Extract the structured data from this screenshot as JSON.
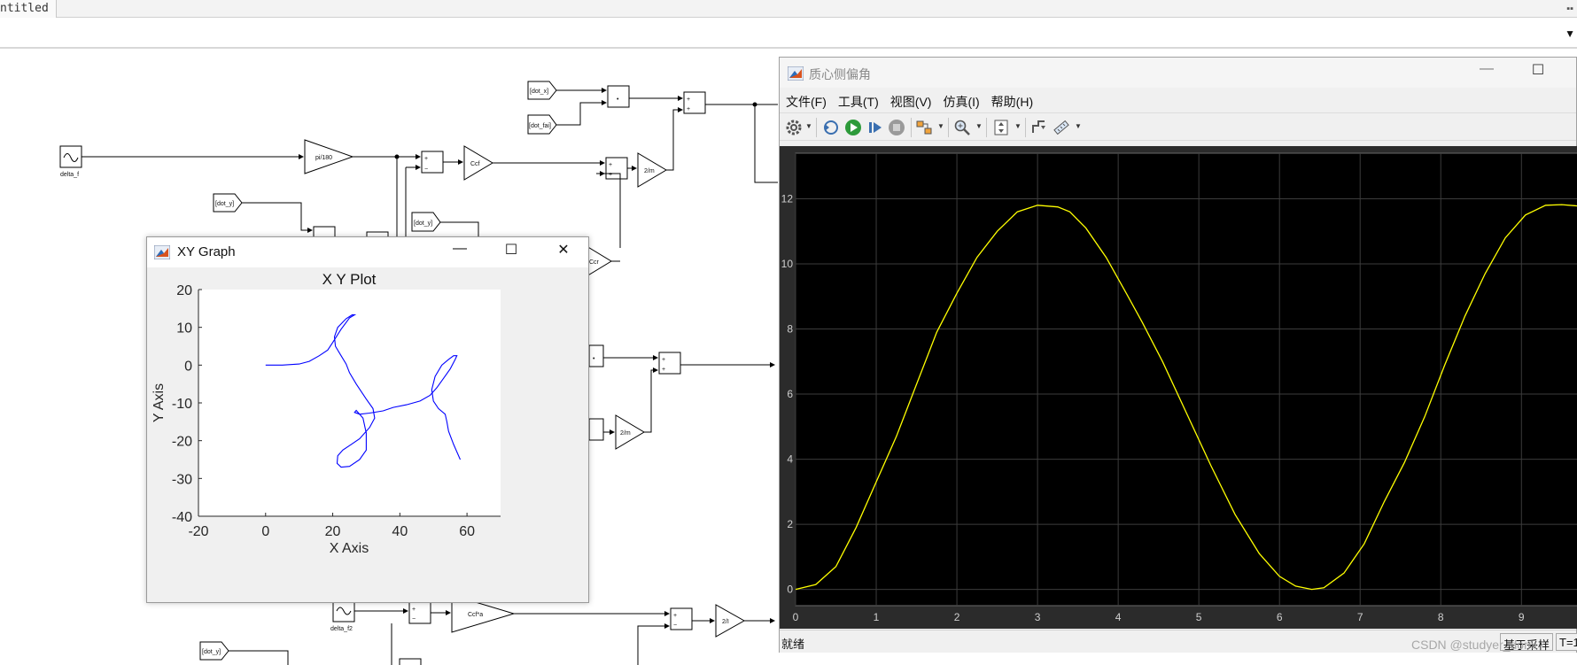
{
  "document": {
    "tab_label": "ntitled"
  },
  "model": {
    "blocks": {
      "delta_f": "delta_f",
      "gain_pi180": "pi/180",
      "dot_y_1": "[dot_y]",
      "dot_y_2": "[dot_y]",
      "dot_y_3": "[dot_y]",
      "dot_x": "[dot_x]",
      "dot_fai": "[dot_fai]",
      "ccf": "Ccf",
      "ccr": "Ccr",
      "gain_2m_1": "2/m",
      "gain_2m_2": "2/m",
      "delta_f2": "delta_f2",
      "ccfa": "Ccf*a",
      "gain_2I": "2/I",
      "product_dot": "•",
      "sum_plus": "+",
      "sum_minus": "−"
    }
  },
  "xy_window": {
    "title": "XY Graph",
    "minimize": "—",
    "maximize": "☐",
    "close": "✕",
    "plot_title": "X Y Plot",
    "xlabel": "X Axis",
    "ylabel": "Y Axis",
    "x_ticks": [
      "-20",
      "0",
      "20",
      "40",
      "60"
    ],
    "y_ticks": [
      "20",
      "10",
      "0",
      "-10",
      "-20",
      "-30",
      "-40"
    ],
    "line_color": "#0000ff",
    "app_icon": "matlab-icon"
  },
  "scope_window": {
    "title": "质心侧偏角",
    "minimize": "—",
    "maximize": "☐",
    "menus": [
      "文件(F)",
      "工具(T)",
      "视图(V)",
      "仿真(I)",
      "帮助(H)"
    ],
    "toolbar_icons": [
      "gear-icon",
      "step-back-icon",
      "run-icon",
      "step-forward-icon",
      "stop-icon",
      "highlight-icon",
      "zoom-icon",
      "autoscale-icon",
      "triggers-icon",
      "measure-icon"
    ],
    "x_ticks": [
      "0",
      "1",
      "2",
      "3",
      "4",
      "5",
      "6",
      "7",
      "8",
      "9"
    ],
    "y_ticks": [
      "12",
      "10",
      "8",
      "6",
      "4",
      "2",
      "0"
    ],
    "line_color": "#ffff00",
    "background": "#000000",
    "status": "就绪",
    "status_sample": "基于采样",
    "status_time": "T=1"
  },
  "watermark": "CSDN @studyer_domi",
  "chart_data": [
    {
      "type": "line",
      "title": "X Y Plot",
      "xlabel": "X Axis",
      "ylabel": "Y Axis",
      "xlim": [
        -20,
        70
      ],
      "ylim": [
        -40,
        20
      ],
      "grid": false,
      "series": [
        {
          "x": [
            0,
            5,
            10,
            13,
            16,
            18.5,
            20,
            22.5,
            25,
            26.5,
            25.8,
            24,
            21.5,
            20.5,
            20.8,
            22.5,
            24,
            25,
            27,
            30,
            32,
            32.5,
            31,
            28,
            25.5,
            23,
            21.5,
            21.3,
            22.5,
            25,
            28,
            30,
            30,
            29,
            27,
            26.5,
            28,
            31,
            35,
            38,
            42,
            46,
            49,
            51,
            53,
            55,
            56.5,
            57,
            56,
            54.5,
            52.5,
            50.5,
            49.5,
            50,
            51.5,
            53.5,
            54,
            54.5,
            56,
            58
          ],
          "y": [
            0,
            0,
            0.3,
            1,
            2.5,
            4,
            6,
            9.5,
            12.5,
            13.3,
            13.3,
            12.3,
            10,
            7.5,
            5,
            2.5,
            0.3,
            -2,
            -5,
            -9,
            -11.5,
            -14,
            -16.5,
            -19.5,
            -21,
            -22.5,
            -24,
            -26,
            -27,
            -26.8,
            -25,
            -22.5,
            -18,
            -14,
            -12,
            -12.5,
            -13,
            -12.7,
            -12.1,
            -11.2,
            -10.5,
            -9.5,
            -8,
            -6,
            -3.5,
            -1,
            1.5,
            2.5,
            2.5,
            1.5,
            0,
            -3,
            -6.5,
            -9.5,
            -11.5,
            -13,
            -15,
            -17.5,
            -21,
            -25
          ]
        }
      ]
    },
    {
      "type": "line",
      "xlim": [
        0,
        9.7
      ],
      "ylim": [
        -0.5,
        13.4
      ],
      "grid": true,
      "series": [
        {
          "x": [
            0,
            0.25,
            0.5,
            0.75,
            1,
            1.25,
            1.5,
            1.75,
            2,
            2.25,
            2.5,
            2.75,
            3,
            3.25,
            3.4,
            3.6,
            3.85,
            4.1,
            4.3,
            4.55,
            4.85,
            5.15,
            5.45,
            5.75,
            6,
            6.2,
            6.4,
            6.55,
            6.8,
            7.05,
            7.3,
            7.55,
            7.8,
            8.05,
            8.3,
            8.55,
            8.8,
            9.05,
            9.3,
            9.5,
            9.7
          ],
          "y": [
            0,
            0.15,
            0.7,
            1.9,
            3.3,
            4.7,
            6.3,
            7.9,
            9.1,
            10.2,
            11,
            11.6,
            11.8,
            11.75,
            11.6,
            11.1,
            10.2,
            9.1,
            8.2,
            7,
            5.4,
            3.8,
            2.3,
            1.1,
            0.4,
            0.1,
            0,
            0.05,
            0.5,
            1.4,
            2.7,
            3.9,
            5.3,
            6.9,
            8.4,
            9.7,
            10.8,
            11.5,
            11.8,
            11.82,
            11.78
          ]
        }
      ]
    }
  ]
}
